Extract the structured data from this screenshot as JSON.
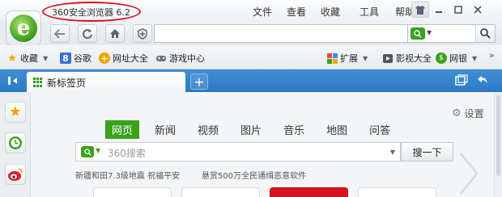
{
  "app": {
    "title": "360安全浏览器 6.2"
  },
  "menu": [
    "文件",
    "查看",
    "收藏",
    "工具",
    "帮助"
  ],
  "window_controls": [
    "skin-icon",
    "minimize-icon",
    "maximize-icon",
    "close-icon"
  ],
  "toolbar": {
    "address_value": "",
    "search_placeholder": ""
  },
  "bookmarks": {
    "left": [
      {
        "label": "收藏",
        "icon": "star-icon"
      },
      {
        "label": "谷歌",
        "icon": "google-icon"
      },
      {
        "label": "网址大全",
        "icon": "plus-circle-icon"
      },
      {
        "label": "游戏中心",
        "icon": "gamepad-icon"
      }
    ],
    "right": [
      {
        "label": "扩展",
        "icon": "apps-icon"
      },
      {
        "label": "影视大全",
        "icon": "film-icon"
      },
      {
        "label": "网银",
        "icon": "shield-bank-icon"
      }
    ]
  },
  "tabs": [
    {
      "label": "新标签页",
      "active": true
    }
  ],
  "newtab": {
    "settings_label": "设置",
    "search_tabs": [
      "网页",
      "新闻",
      "视频",
      "图片",
      "音乐",
      "地图",
      "问答"
    ],
    "active_search_tab": "网页",
    "search_placeholder": "360搜索",
    "search_button": "搜一下",
    "news": [
      "新疆和田7.3级地震 祝福平安",
      "悬赏500万全民通缉恶意软件"
    ]
  },
  "colors": {
    "accent_green": "#3aa21a",
    "tab_blue": "#2f80c9",
    "annotation_red": "#d6151d"
  }
}
